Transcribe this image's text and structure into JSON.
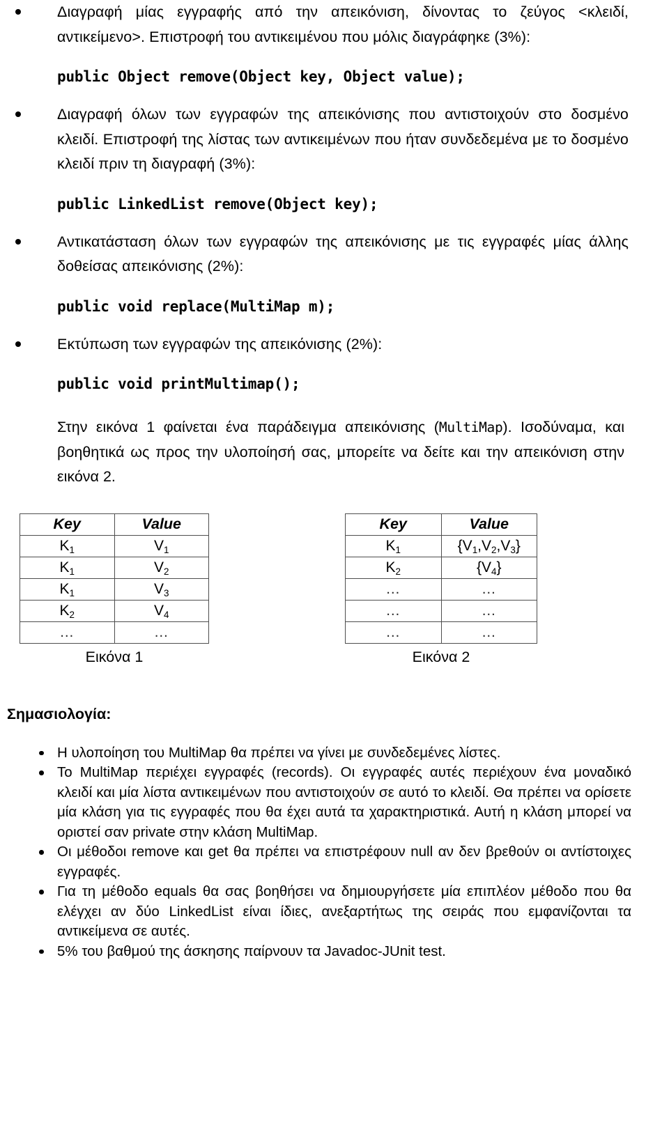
{
  "document": {
    "spec_items": [
      {
        "description": "Διαγραφή μίας εγγραφής από την απεικόνιση, δίνοντας το ζεύγος <κλειδί, αντικείμενο>. Επιστροφή του αντικειμένου που μόλις διαγράφηκε (3%):",
        "signature": "public Object remove(Object key, Object value);"
      },
      {
        "description": "Διαγραφή όλων των εγγραφών της απεικόνισης που αντιστοιχούν στο δοσμένο κλειδί. Επιστροφή της λίστας των αντικειμένων που ήταν συνδεδεμένα με το δοσμένο κλειδί πριν τη διαγραφή (3%):",
        "signature": "public LinkedList remove(Object key);"
      },
      {
        "description": "Αντικατάσταση όλων των εγγραφών της απεικόνισης με τις εγγραφές μίας άλλης δοθείσας απεικόνισης (2%):",
        "signature": "public void replace(MultiMap m);"
      },
      {
        "description": "Εκτύπωση των εγγραφών της απεικόνισης (2%):",
        "signature": "public void printMultimap();"
      }
    ],
    "figure_paragraph": {
      "part1": "Στην εικόνα 1 φαίνεται ένα παράδειγμα απεικόνισης (",
      "mono": "MultiMap",
      "part2": "). Ισοδύναμα, και βοηθητικά ως προς την υλοποίησή σας, μπορείτε να δείτε και την απεικόνιση στην εικόνα 2."
    },
    "figures": [
      {
        "caption": "Εικόνα 1",
        "headers": [
          "Key",
          "Value"
        ],
        "rows": [
          {
            "key": "K",
            "key_sub": "1",
            "value": "V",
            "value_sub": "1",
            "dots": false
          },
          {
            "key": "K",
            "key_sub": "1",
            "value": "V",
            "value_sub": "2",
            "dots": false
          },
          {
            "key": "K",
            "key_sub": "1",
            "value": "V",
            "value_sub": "3",
            "dots": false
          },
          {
            "key": "K",
            "key_sub": "2",
            "value": "V",
            "value_sub": "4",
            "dots": false
          },
          {
            "key": "…",
            "key_sub": "",
            "value": "…",
            "value_sub": "",
            "dots": true
          }
        ]
      },
      {
        "caption": "Εικόνα 2",
        "headers": [
          "Key",
          "Value"
        ],
        "rows": [
          {
            "key": "K",
            "key_sub": "1",
            "value_set": [
              "V1",
              "V2",
              "V3"
            ],
            "dots": false
          },
          {
            "key": "K",
            "key_sub": "2",
            "value_set": [
              "V4"
            ],
            "dots": false
          },
          {
            "key": "…",
            "key_sub": "",
            "value": "…",
            "dots": true
          },
          {
            "key": "…",
            "key_sub": "",
            "value": "…",
            "dots": true
          },
          {
            "key": "…",
            "key_sub": "",
            "value": "…",
            "dots": true
          }
        ]
      }
    ],
    "semantics_heading": "Σημασιολογία:",
    "notes": [
      "Η υλοποίηση του MultiMap θα πρέπει να γίνει με συνδεδεμένες λίστες.",
      "Το MultiMap περιέχει εγγραφές (records). Οι εγγραφές αυτές περιέχουν ένα μοναδικό κλειδί και μία λίστα αντικειμένων που αντιστοιχούν σε αυτό το κλειδί. Θα πρέπει να ορίσετε μία κλάση για τις εγγραφές που θα έχει αυτά τα χαρακτηριστικά. Αυτή η κλάση μπορεί να οριστεί σαν private στην κλάση MultiMap.",
      "Οι μέθοδοι remove και get θα πρέπει να επιστρέφουν null αν δεν βρεθούν οι αντίστοιχες εγγραφές.",
      "Για τη μέθοδο equals θα σας βοηθήσει να δημιουργήσετε μία επιπλέον μέθοδο που θα ελέγχει αν δύο LinkedList είναι ίδιες, ανεξαρτήτως της σειράς που εμφανίζονται τα αντικείμενα σε αυτές.",
      "5% του βαθμού της άσκησης παίρνουν τα Javadoc-JUnit test."
    ]
  }
}
